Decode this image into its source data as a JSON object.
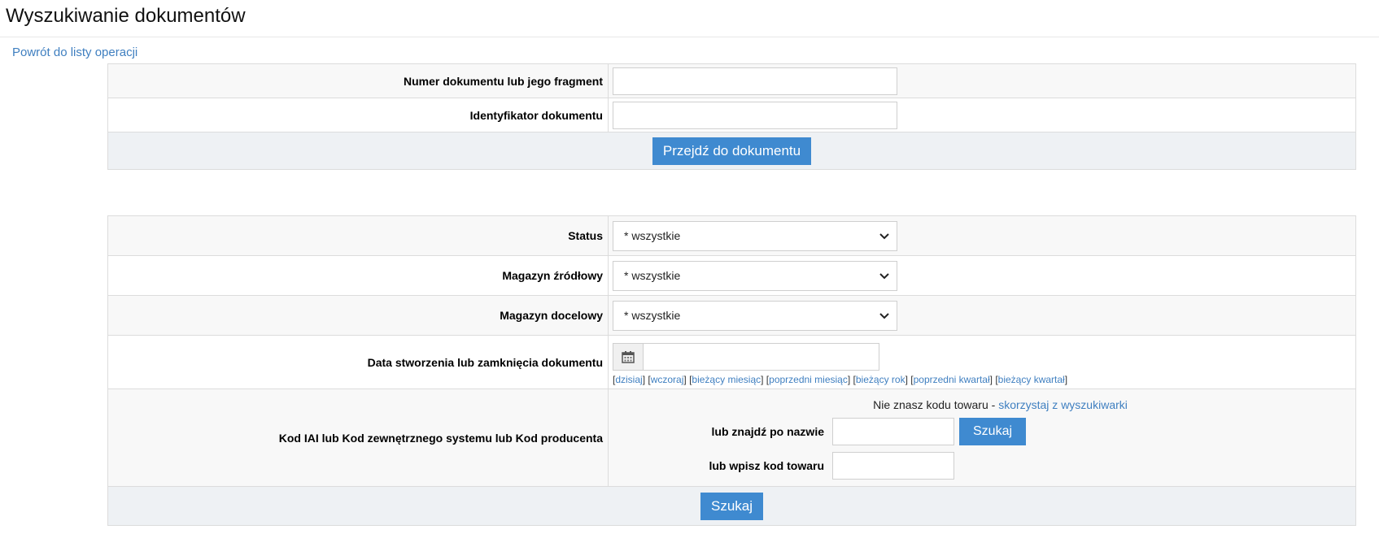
{
  "page": {
    "title": "Wyszukiwanie dokumentów"
  },
  "nav": {
    "back_link": "Powrót do listy operacji"
  },
  "document_search": {
    "number_label": "Numer dokumentu lub jego fragment",
    "number_value": "",
    "id_label": "Identyfikator dokumentu",
    "id_value": "",
    "go_button": "Przejdź do dokumentu"
  },
  "filters": {
    "status_label": "Status",
    "status_value": "* wszystkie",
    "source_label": "Magazyn źródłowy",
    "source_value": "* wszystkie",
    "target_label": "Magazyn docelowy",
    "target_value": "* wszystkie",
    "date_label": "Data stworzenia lub zamknięcia dokumentu",
    "date_value": "",
    "date_icon": "calendar-icon",
    "quick_links": [
      "dzisiaj",
      "wczoraj",
      "bieżący miesiąc",
      "poprzedni miesiąc",
      "bieżący rok",
      "poprzedni kwartał",
      "bieżący kwartał"
    ]
  },
  "product": {
    "label": "Kod IAI lub Kod zewnętrznego systemu lub Kod producenta",
    "hint_text": "Nie znasz kodu towaru - ",
    "hint_link": "skorzystaj z wyszukiwarki",
    "by_name_label": "lub znajdź po nazwie",
    "by_name_value": "",
    "by_name_button": "Szukaj",
    "by_code_label": "lub wpisz kod towaru",
    "by_code_value": ""
  },
  "search_button": "Szukaj",
  "colors": {
    "accent": "#3f8ad0",
    "link": "#3f7fc0"
  }
}
